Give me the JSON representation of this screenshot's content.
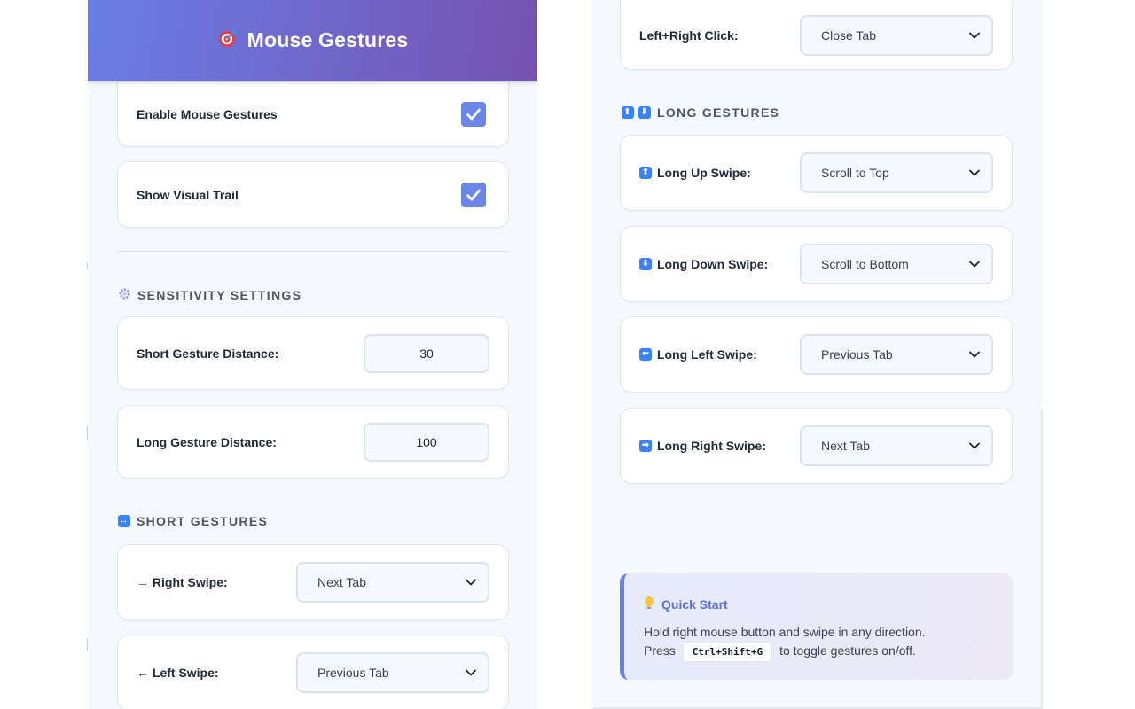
{
  "header": {
    "title": "Mouse Gestures",
    "icon": "target-icon"
  },
  "toggles": [
    {
      "label": "Enable Mouse Gestures",
      "checked": true
    },
    {
      "label": "Show Visual Trail",
      "checked": true
    }
  ],
  "sensitivity": {
    "title": "SENSITIVITY SETTINGS",
    "icon": "gear-icon",
    "fields": [
      {
        "label": "Short Gesture Distance:",
        "value": "30"
      },
      {
        "label": "Long Gesture Distance:",
        "value": "100"
      }
    ]
  },
  "short_gestures": {
    "title": "SHORT GESTURES",
    "icon": "left-right-arrow-icon",
    "items": [
      {
        "label": "→ Right Swipe:",
        "value": "Next Tab"
      },
      {
        "label": "← Left Swipe:",
        "value": "Previous Tab"
      }
    ]
  },
  "mouse_combo": {
    "label": "Left+Right Click:",
    "value": "Close Tab"
  },
  "long_gestures": {
    "title": "LONG GESTURES",
    "icons": [
      "up-arrow-icon",
      "down-arrow-icon"
    ],
    "items": [
      {
        "label": "Long Up Swipe:",
        "value": "Scroll to Top",
        "icon": "⬆"
      },
      {
        "label": "Long Down Swipe:",
        "value": "Scroll to Bottom",
        "icon": "⬇"
      },
      {
        "label": "Long Left Swipe:",
        "value": "Previous Tab",
        "icon": "⬅"
      },
      {
        "label": "Long Right Swipe:",
        "value": "Next Tab",
        "icon": "➡"
      }
    ]
  },
  "quick_start": {
    "title": "Quick Start",
    "icon": "lightbulb-icon",
    "line1": "Hold right mouse button and swipe in any direction.",
    "line2_prefix": "Press",
    "shortcut": "Ctrl+Shift+G",
    "line2_suffix": "to toggle gestures on/off."
  },
  "colors": {
    "accent": "#6a7ee6",
    "accent_dark": "#7552b0",
    "checkbox": "#6b86e6",
    "quick_title": "#5b6fd6"
  }
}
